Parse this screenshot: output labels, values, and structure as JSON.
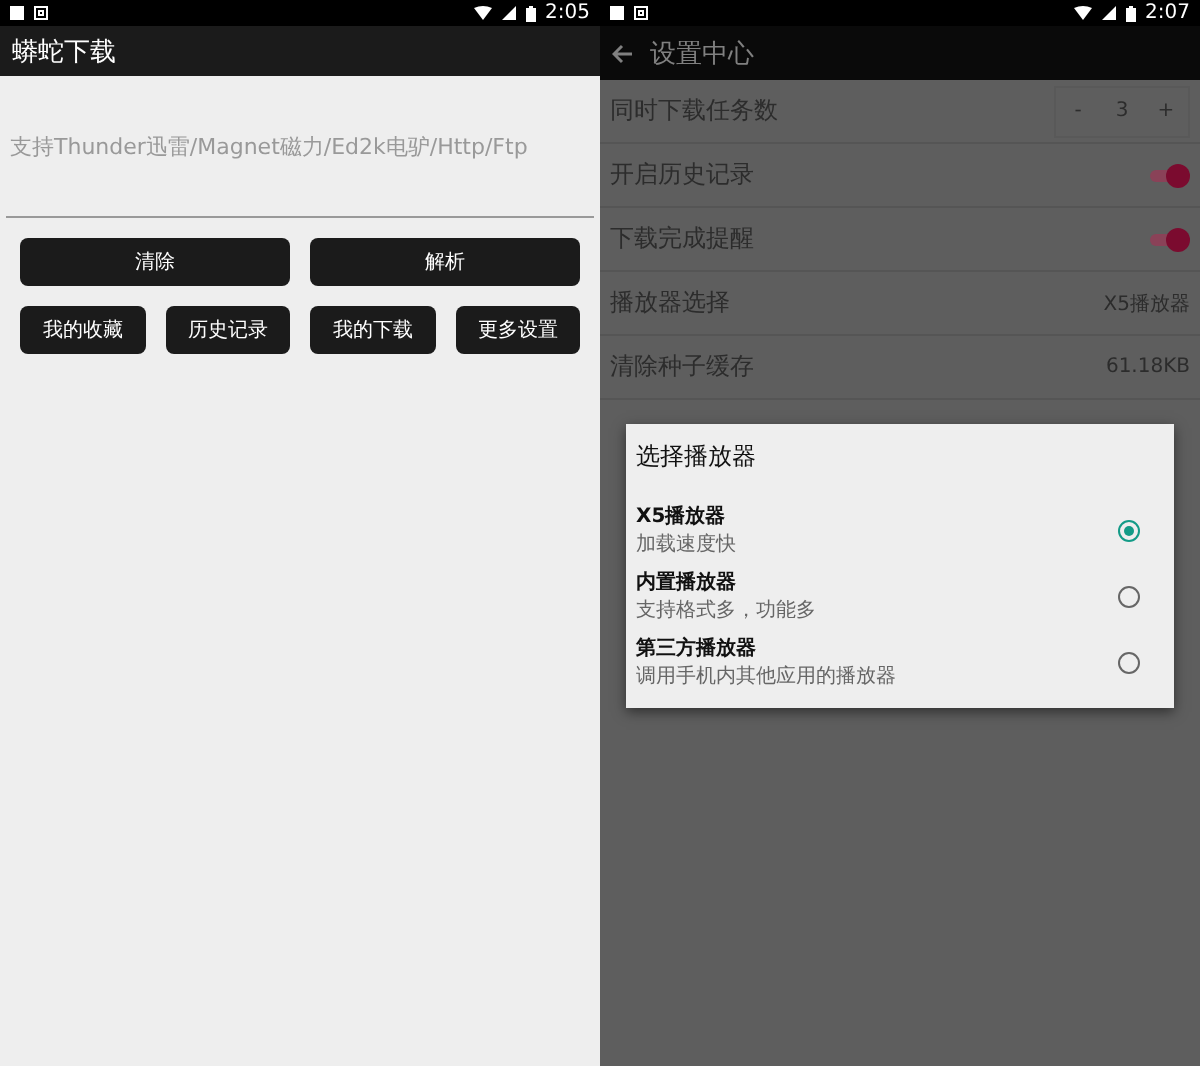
{
  "left": {
    "status_bar": {
      "time": "2:05"
    },
    "toolbar": {
      "title": "蟒蛇下载"
    },
    "link_input": {
      "placeholder": "支持Thunder迅雷/Magnet磁力/Ed2k电驴/Http/Ftp"
    },
    "buttons": [
      "清除",
      "解析"
    ],
    "quick_buttons": [
      "我的收藏",
      "历史记录",
      "我的下载",
      "更多设置"
    ]
  },
  "right": {
    "status_bar": {
      "time": "2:07"
    },
    "toolbar": {
      "title": "设置中心"
    },
    "settings": [
      {
        "kind": "stepper",
        "label": "同时下载任务数",
        "minus": "-",
        "value": "3",
        "plus": "+"
      },
      {
        "kind": "switch",
        "label": "开启历史记录",
        "on": true
      },
      {
        "kind": "switch",
        "label": "下载完成提醒",
        "on": true
      },
      {
        "kind": "value",
        "label": "播放器选择",
        "value": "X5播放器"
      },
      {
        "kind": "value",
        "label": "清除种子缓存",
        "value": "61.18KB"
      }
    ],
    "dialog": {
      "title": "选择播放器",
      "options": [
        {
          "label": "X5播放器",
          "description": "加载速度快",
          "selected": true
        },
        {
          "label": "内置播放器",
          "description": "支持格式多，功能多",
          "selected": false
        },
        {
          "label": "第三方播放器",
          "description": "调用手机内其他应用的播放器",
          "selected": false
        }
      ]
    }
  }
}
